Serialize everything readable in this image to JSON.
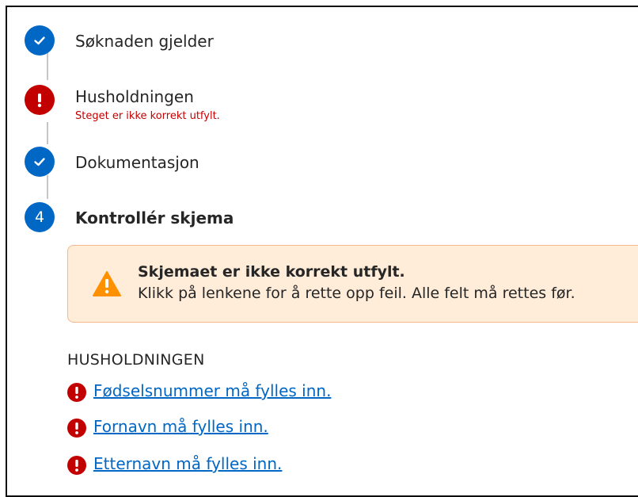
{
  "steps": [
    {
      "status": "done",
      "title": "Søknaden gjelder",
      "icon": "check-icon"
    },
    {
      "status": "error",
      "title": "Husholdningen",
      "error": "Steget er ikke korrekt utfylt.",
      "icon": "exclamation-icon"
    },
    {
      "status": "done",
      "title": "Dokumentasjon",
      "icon": "check-icon"
    },
    {
      "status": "current",
      "number": "4",
      "title": "Kontrollér skjema"
    }
  ],
  "alert": {
    "title": "Skjemaet er ikke korrekt utfylt.",
    "text": "Klikk på lenkene for å rette opp feil. Alle felt må rettes før.",
    "icon": "warning-icon"
  },
  "errors_section": {
    "heading": "HUSHOLDNINGEN",
    "items": [
      {
        "label": "Fødselsnummer må fylles inn.",
        "icon": "error-icon"
      },
      {
        "label": "Fornavn må fylles inn.",
        "icon": "error-icon"
      },
      {
        "label": "Etternavn må fylles inn.",
        "icon": "error-icon"
      }
    ]
  },
  "colors": {
    "primary_blue": "#0067c5",
    "error_red": "#c30000",
    "warning_bg": "#ffecd9",
    "warning_orange": "#ff9100"
  }
}
